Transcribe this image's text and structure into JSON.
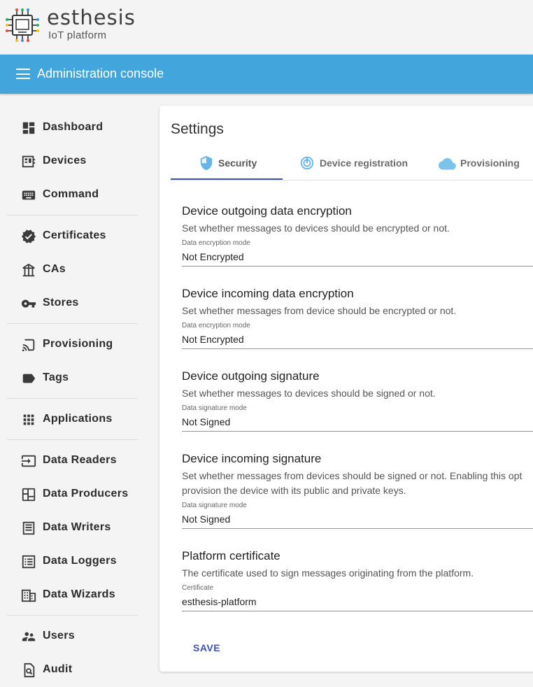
{
  "brand": {
    "name": "esthesis",
    "subtitle": "IoT platform"
  },
  "topbar": {
    "title": "Administration console"
  },
  "sidebar": {
    "items": [
      {
        "label": "Dashboard",
        "icon": "dashboard-icon"
      },
      {
        "label": "Devices",
        "icon": "devices-icon"
      },
      {
        "label": "Command",
        "icon": "keyboard-icon"
      },
      {
        "label": "Certificates",
        "icon": "verified-badge-icon"
      },
      {
        "label": "CAs",
        "icon": "account-tree-icon"
      },
      {
        "label": "Stores",
        "icon": "key-icon"
      },
      {
        "label": "Provisioning",
        "icon": "cast-icon"
      },
      {
        "label": "Tags",
        "icon": "label-icon"
      },
      {
        "label": "Applications",
        "icon": "apps-grid-icon"
      },
      {
        "label": "Data Readers",
        "icon": "input-icon"
      },
      {
        "label": "Data Producers",
        "icon": "dashboard-outline-icon"
      },
      {
        "label": "Data Writers",
        "icon": "storage-icon"
      },
      {
        "label": "Data Loggers",
        "icon": "list-icon"
      },
      {
        "label": "Data Wizards",
        "icon": "grid-icon"
      },
      {
        "label": "Users",
        "icon": "people-icon"
      },
      {
        "label": "Audit",
        "icon": "find-in-page-icon"
      }
    ]
  },
  "settings": {
    "title": "Settings",
    "tabs": [
      {
        "label": "Security",
        "icon": "shield-icon"
      },
      {
        "label": "Device registration",
        "icon": "registration-icon"
      },
      {
        "label": "Provisioning",
        "icon": "cloud-icon"
      }
    ],
    "sections": [
      {
        "title": "Device outgoing data encryption",
        "description": "Set whether messages to devices should be encrypted or not.",
        "field_label": "Data encryption mode",
        "value": "Not Encrypted"
      },
      {
        "title": "Device incoming data encryption",
        "description": "Set whether messages from device should be encrypted or not.",
        "field_label": "Data encryption mode",
        "value": "Not Encrypted"
      },
      {
        "title": "Device outgoing signature",
        "description": "Set whether messages to devices should be signed or not.",
        "field_label": "Data signature mode",
        "value": "Not Signed"
      },
      {
        "title": "Device incoming signature",
        "description": "Set whether messages from devices should be signed or not. Enabling this opt",
        "description2": "provision the device with its public and private keys.",
        "field_label": "Data signature mode",
        "value": "Not Signed"
      },
      {
        "title": "Platform certificate",
        "description": "The certificate used to sign messages originating from the platform.",
        "field_label": "Certificate",
        "value": "esthesis-platform"
      }
    ],
    "save_label": "SAVE"
  },
  "colors": {
    "topbar": "#42a5dc",
    "accent": "#3f51b5",
    "icon": "#3a3a3a",
    "tab_icon": "#64b5e8"
  }
}
